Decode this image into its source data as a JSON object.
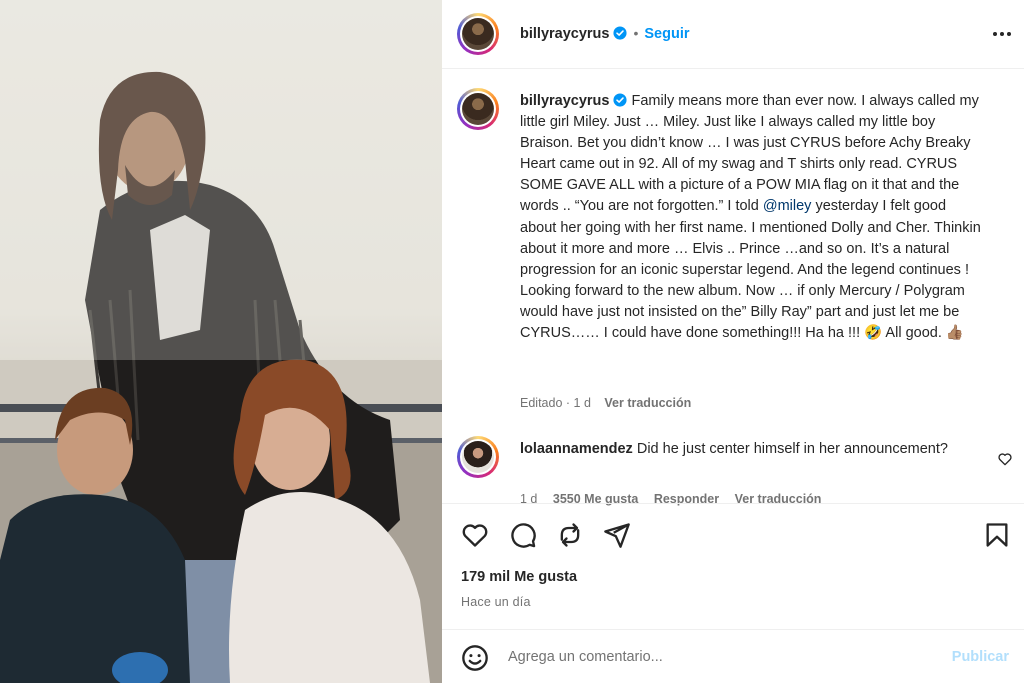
{
  "post": {
    "username": "billyraycyrus",
    "follow_label": "Seguir",
    "separator": "•",
    "caption_parts": {
      "p1": "Family means more than ever now. I always called my little girl Miley. Just … Miley.  Just like I always called my little boy Braison. Bet you didn’t know … I was just CYRUS before Achy Breaky Heart came out in 92. All of my swag and T shirts only read. CYRUS  SOME GAVE ALL with a picture of a POW MIA flag on it that and the words  ..  “You are not forgotten.” I told ",
      "mention": "@miley",
      "p2": " yesterday I felt good about her going with her first name. I mentioned Dolly and Cher. Thinkin about it more and more … Elvis .. Prince …and so on. It’s a natural progression for an iconic superstar legend. And the legend continues ! Looking forward to the new album. Now … if only Mercury / Polygram would have just not insisted on the” Billy Ray” part and just let me be CYRUS……  I could have done something!!!  Ha ha !!! 🤣 All good.  👍🏽"
    },
    "edited_label": "Editado",
    "edited_time": "1 d",
    "see_translation": "Ver traducción"
  },
  "comment": {
    "username": "lolaannamendez",
    "text": "Did he just center himself in her announcement?",
    "time": "1 d",
    "likes": "3550 Me gusta",
    "reply": "Responder",
    "see_translation": "Ver traducción"
  },
  "footer": {
    "likes": "179 mil Me gusta",
    "time": "Hace un día",
    "comment_placeholder": "Agrega un comentario...",
    "publish_label": "Publicar"
  },
  "icons": {
    "verified": "verified-badge-icon",
    "more": "more-options-icon",
    "like": "heart-icon",
    "comment": "comment-icon",
    "share": "repost-icon",
    "send": "send-icon",
    "save": "bookmark-icon",
    "emoji": "emoji-icon"
  },
  "colors": {
    "link_blue": "#0095f6",
    "mention": "#00376b",
    "secondary_text": "#737373",
    "publish_disabled": "#b2dffc",
    "verified": "#0095f6"
  }
}
